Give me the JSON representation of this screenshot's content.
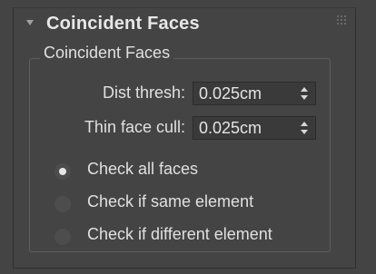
{
  "rollout": {
    "title": "Coincident Faces",
    "collapse_icon": "triangle-down-icon",
    "grip_icon": "drag-grip-icon"
  },
  "group": {
    "title": "Coincident Faces"
  },
  "fields": {
    "dist_thresh": {
      "label": "Dist thresh:",
      "value": "0.025cm"
    },
    "thin_face_cull": {
      "label": "Thin face cull:",
      "value": "0.025cm"
    }
  },
  "options": [
    {
      "label": "Check all faces",
      "checked": true
    },
    {
      "label": "Check if same element",
      "checked": false
    },
    {
      "label": "Check if different element",
      "checked": false
    }
  ],
  "colors": {
    "background": "#444444",
    "text": "#e0e0e0",
    "spinner_bg": "#3a3a3a"
  }
}
